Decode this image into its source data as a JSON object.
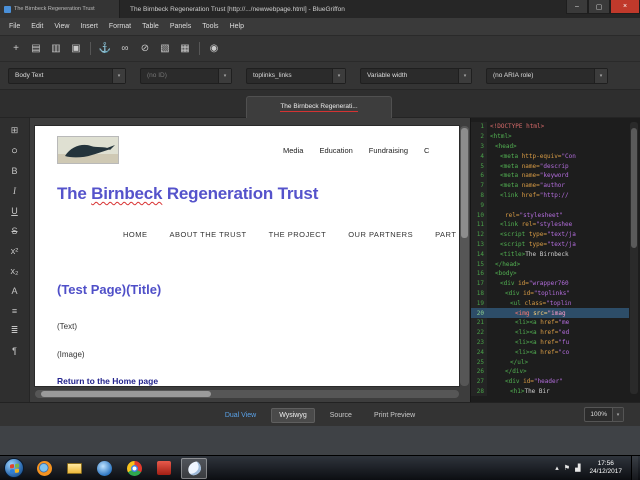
{
  "ui": {
    "chevron_down": "▾"
  },
  "titlebar": {
    "tab_title": "The Birnbeck Regeneration Trust",
    "window_title": "The Birnbeck Regeneration Trust [http://.../newwebpage.html] - BlueGriffon"
  },
  "window_controls": [
    {
      "name": "minimize-button",
      "glyph": "–"
    },
    {
      "name": "maximize-button",
      "glyph": "▢"
    },
    {
      "name": "close-button",
      "glyph": "×",
      "close": true
    }
  ],
  "menubar": [
    "File",
    "Edit",
    "View",
    "Insert",
    "Format",
    "Table",
    "Panels",
    "Tools",
    "Help"
  ],
  "main_toolbar": [
    {
      "name": "add-icon",
      "glyph": "+"
    },
    {
      "name": "new-document-icon",
      "glyph": "▤"
    },
    {
      "name": "open-document-icon",
      "glyph": "▥"
    },
    {
      "name": "save-icon",
      "glyph": "▣"
    },
    {
      "name": "separator",
      "glyph": "",
      "sep": true
    },
    {
      "name": "anchor-icon",
      "glyph": "⚓"
    },
    {
      "name": "link-icon",
      "glyph": "∞"
    },
    {
      "name": "unlink-icon",
      "glyph": "⊘"
    },
    {
      "name": "image-icon",
      "glyph": "▧"
    },
    {
      "name": "table-icon",
      "glyph": "▦"
    },
    {
      "name": "separator",
      "glyph": "",
      "sep": true
    },
    {
      "name": "globe-icon",
      "glyph": "◉"
    }
  ],
  "format_bar": [
    {
      "name": "paragraph-format-dropdown",
      "label": "Body Text"
    },
    {
      "name": "id-dropdown",
      "label": "(no ID)",
      "dim": true
    },
    {
      "name": "class-dropdown",
      "label": "toplinks_links"
    },
    {
      "name": "width-dropdown",
      "label": "Variable width"
    },
    {
      "name": "aria-role-dropdown",
      "label": "(no ARIA role)"
    }
  ],
  "doc_tab": {
    "label": "The Birnbeck Regenerati..."
  },
  "side_toolbar": [
    {
      "name": "grid-icon",
      "glyph": "⊞"
    },
    {
      "name": "circle-icon",
      "glyph": "○"
    },
    {
      "name": "bold-icon",
      "glyph": "B"
    },
    {
      "name": "italic-icon",
      "glyph": "I"
    },
    {
      "name": "underline-icon",
      "glyph": "U"
    },
    {
      "name": "strikethrough-icon",
      "glyph": "S"
    },
    {
      "name": "superscript-icon",
      "glyph": "x²"
    },
    {
      "name": "subscript-icon",
      "glyph": "x₂"
    },
    {
      "name": "font-color-icon",
      "glyph": "A"
    },
    {
      "name": "unordered-list-icon",
      "glyph": "≡"
    },
    {
      "name": "ordered-list-icon",
      "glyph": "≣"
    },
    {
      "name": "paragraph-icon",
      "glyph": "¶"
    }
  ],
  "page": {
    "top_nav": [
      "Media",
      "Education",
      "Fundraising",
      "C"
    ],
    "heading_pre": "The ",
    "heading_word": "Birnbeck",
    "heading_post": " Regeneration Trust",
    "main_nav": [
      "HOME",
      "ABOUT THE TRUST",
      "THE PROJECT",
      "OUR PARTNERS",
      "PART"
    ],
    "title_placeholder": "(Test Page)(Title)",
    "text_placeholder": "(Text)",
    "image_placeholder": "(Image)",
    "home_link": "Return to the Home page"
  },
  "source": {
    "zoom": "100%",
    "lines": [
      {
        "n": 1,
        "ind": 0,
        "seg": [
          [
            "doctype",
            "<!DOCTYPE html>"
          ]
        ]
      },
      {
        "n": 2,
        "ind": 0,
        "seg": [
          [
            "tag",
            "<html>"
          ]
        ]
      },
      {
        "n": 3,
        "ind": 1,
        "seg": [
          [
            "tag",
            "<head>"
          ]
        ]
      },
      {
        "n": 4,
        "ind": 2,
        "seg": [
          [
            "tag",
            "<meta "
          ],
          [
            "attr",
            "http-equiv="
          ],
          [
            "str",
            "\"Con"
          ]
        ]
      },
      {
        "n": 5,
        "ind": 2,
        "seg": [
          [
            "tag",
            "<meta "
          ],
          [
            "attr",
            "name="
          ],
          [
            "str",
            "\"descrip"
          ]
        ]
      },
      {
        "n": 6,
        "ind": 2,
        "seg": [
          [
            "tag",
            "<meta "
          ],
          [
            "attr",
            "name="
          ],
          [
            "str",
            "\"keyword"
          ]
        ]
      },
      {
        "n": 7,
        "ind": 2,
        "seg": [
          [
            "tag",
            "<meta "
          ],
          [
            "attr",
            "name="
          ],
          [
            "str",
            "\"author"
          ]
        ]
      },
      {
        "n": 8,
        "ind": 2,
        "seg": [
          [
            "tag",
            "<link "
          ],
          [
            "attr",
            "href="
          ],
          [
            "str",
            "\"http://"
          ]
        ]
      },
      {
        "n": 9,
        "ind": 0,
        "seg": []
      },
      {
        "n": 10,
        "ind": 3,
        "seg": [
          [
            "attr",
            "rel="
          ],
          [
            "str",
            "\"stylesheet\""
          ]
        ]
      },
      {
        "n": 11,
        "ind": 2,
        "seg": [
          [
            "tag",
            "<link "
          ],
          [
            "attr",
            "rel="
          ],
          [
            "str",
            "\"styleshee"
          ]
        ]
      },
      {
        "n": 12,
        "ind": 2,
        "seg": [
          [
            "tag",
            "<script "
          ],
          [
            "attr",
            "type="
          ],
          [
            "str",
            "\"text/ja"
          ]
        ]
      },
      {
        "n": 13,
        "ind": 2,
        "seg": [
          [
            "tag",
            "<script "
          ],
          [
            "attr",
            "type="
          ],
          [
            "str",
            "\"text/ja"
          ]
        ]
      },
      {
        "n": 14,
        "ind": 2,
        "seg": [
          [
            "tag",
            "<title>"
          ],
          [
            "text",
            "The Birnbeck"
          ]
        ]
      },
      {
        "n": 15,
        "ind": 1,
        "seg": [
          [
            "tag",
            "</head>"
          ]
        ]
      },
      {
        "n": 16,
        "ind": 1,
        "seg": [
          [
            "tag",
            "<body>"
          ]
        ]
      },
      {
        "n": 17,
        "ind": 2,
        "seg": [
          [
            "tag",
            "<div "
          ],
          [
            "attr",
            "id="
          ],
          [
            "str",
            "\"wrapper760"
          ]
        ]
      },
      {
        "n": 18,
        "ind": 3,
        "seg": [
          [
            "tag",
            "<div "
          ],
          [
            "attr",
            "id="
          ],
          [
            "str",
            "\"toplinks\""
          ]
        ]
      },
      {
        "n": 19,
        "ind": 4,
        "seg": [
          [
            "tag",
            "<ul "
          ],
          [
            "attr",
            "class="
          ],
          [
            "str",
            "\"toplin"
          ]
        ]
      },
      {
        "n": 20,
        "ind": 5,
        "sel": true,
        "seg": [
          [
            "tag",
            "<img "
          ],
          [
            "attr",
            "src="
          ],
          [
            "str",
            "\"imag"
          ]
        ]
      },
      {
        "n": 21,
        "ind": 5,
        "seg": [
          [
            "tag",
            "<li><a "
          ],
          [
            "attr",
            "href="
          ],
          [
            "str",
            "\"me"
          ]
        ]
      },
      {
        "n": 22,
        "ind": 5,
        "seg": [
          [
            "tag",
            "<li><a "
          ],
          [
            "attr",
            "href="
          ],
          [
            "str",
            "\"ed"
          ]
        ]
      },
      {
        "n": 23,
        "ind": 5,
        "seg": [
          [
            "tag",
            "<li><a "
          ],
          [
            "attr",
            "href="
          ],
          [
            "str",
            "\"fu"
          ]
        ]
      },
      {
        "n": 24,
        "ind": 5,
        "seg": [
          [
            "tag",
            "<li><a "
          ],
          [
            "attr",
            "href="
          ],
          [
            "str",
            "\"co"
          ]
        ]
      },
      {
        "n": 25,
        "ind": 4,
        "seg": [
          [
            "tag",
            "</ul>"
          ]
        ]
      },
      {
        "n": 26,
        "ind": 3,
        "seg": [
          [
            "tag",
            "</div>"
          ]
        ]
      },
      {
        "n": 27,
        "ind": 3,
        "seg": [
          [
            "tag",
            "<div "
          ],
          [
            "attr",
            "id="
          ],
          [
            "str",
            "\"header\""
          ]
        ]
      },
      {
        "n": 28,
        "ind": 4,
        "seg": [
          [
            "tag",
            "<h1>"
          ],
          [
            "text",
            "The Bir"
          ]
        ]
      }
    ]
  },
  "view_buttons": [
    {
      "name": "dual-view-button",
      "label": "Dual View",
      "active": true
    },
    {
      "name": "wysiwyg-button",
      "label": "Wysiwyg",
      "raised": true
    },
    {
      "name": "source-button",
      "label": "Source"
    },
    {
      "name": "print-preview-button",
      "label": "Print Preview"
    }
  ],
  "taskbar": {
    "time": "17:56",
    "date": "24/12/2017",
    "apps": [
      {
        "btn": "firefox-taskbar-button",
        "icon": "firefox-icon"
      },
      {
        "btn": "explorer-taskbar-button",
        "icon": "explorer-icon"
      },
      {
        "btn": "media-player-taskbar-button",
        "icon": "media-player-icon"
      },
      {
        "btn": "chrome-taskbar-button",
        "icon": "chrome-icon"
      },
      {
        "btn": "red-app-taskbar-button",
        "icon": "red-app-icon"
      },
      {
        "btn": "bluegriffon-taskbar-button",
        "icon": "bluegriffon-icon",
        "active": true
      }
    ],
    "tray": [
      {
        "name": "hidden-icons-icon",
        "glyph": "▴"
      },
      {
        "name": "action-center-flag-icon",
        "glyph": "⚑"
      },
      {
        "name": "network-icon",
        "glyph": "▟"
      }
    ]
  }
}
